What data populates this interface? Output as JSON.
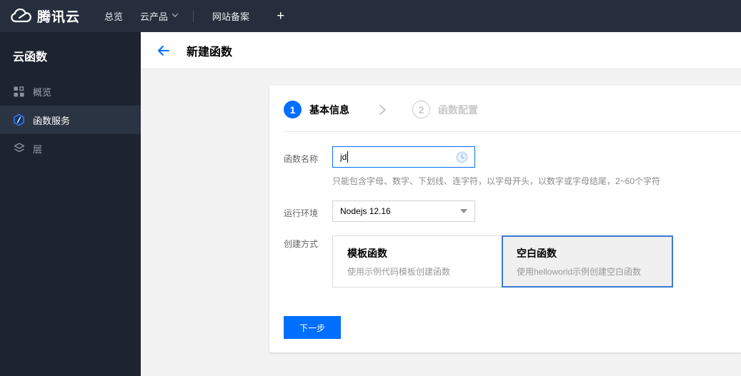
{
  "colors": {
    "accent": "#006eff",
    "navbar_bg": "#262e3d",
    "sidebar_bg": "#1d242f",
    "sidebar_selected_bg": "#2b3442",
    "selected_card_border": "#3c7bd0"
  },
  "navbar": {
    "brand": "腾讯云",
    "items": [
      {
        "label": "总览"
      },
      {
        "label": "云产品",
        "has_caret": true
      },
      {
        "label": "网站备案"
      }
    ],
    "add_tab_label": "+"
  },
  "sidebar": {
    "title": "云函数",
    "items": [
      {
        "label": "概览",
        "icon": "grid-icon",
        "selected": false
      },
      {
        "label": "函数服务",
        "icon": "scf-hexagon-icon",
        "selected": true
      },
      {
        "label": "层",
        "icon": "layers-icon",
        "selected": false
      }
    ]
  },
  "header": {
    "title": "新建函数"
  },
  "steps": [
    {
      "number": "1",
      "label": "基本信息",
      "active": true
    },
    {
      "number": "2",
      "label": "函数配置",
      "active": false
    }
  ],
  "form": {
    "function_name": {
      "label": "函数名称",
      "value": "jd",
      "helper": "只能包含字母、数字、下划线、连字符，以字母开头，以数字或字母结尾，2~60个字符",
      "suffix_icon": "clock-icon"
    },
    "runtime": {
      "label": "运行环境",
      "value": "Nodejs 12.16"
    },
    "creation_method": {
      "label": "创建方式",
      "options": [
        {
          "title": "模板函数",
          "description": "使用示例代码模板创建函数",
          "selected": false
        },
        {
          "title": "空白函数",
          "description": "使用helloworld示例创建空白函数",
          "selected": true
        }
      ]
    },
    "next_button": "下一步"
  }
}
